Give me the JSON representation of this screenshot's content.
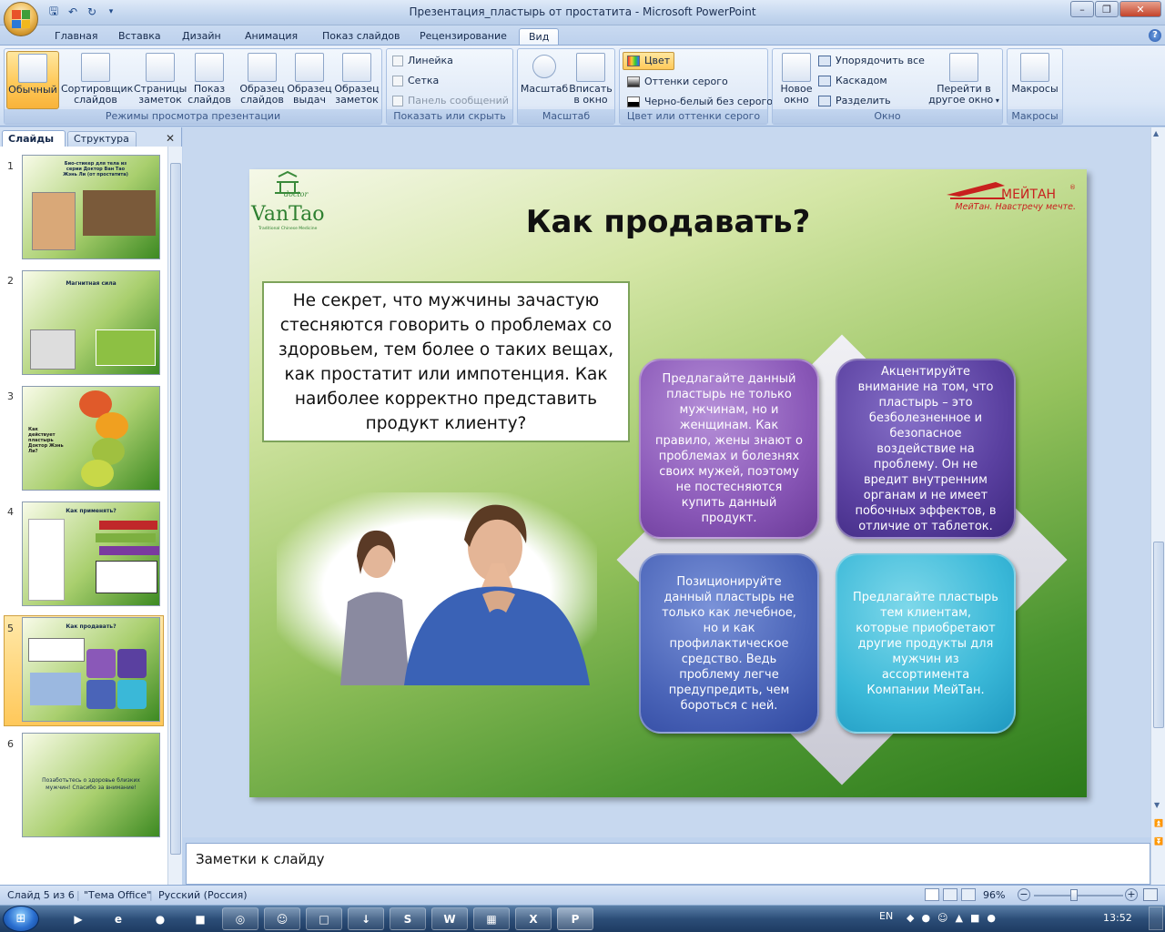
{
  "window": {
    "title": "Презентация_пластырь от простатита - Microsoft PowerPoint"
  },
  "ribbon_tabs": [
    "Главная",
    "Вставка",
    "Дизайн",
    "Анимация",
    "Показ слайдов",
    "Рецензирование",
    "Вид"
  ],
  "active_tab": "Вид",
  "ribbon": {
    "views_group": {
      "label": "Режимы просмотра презентации",
      "buttons": [
        {
          "label1": "Обычный",
          "label2": ""
        },
        {
          "label1": "Сортировщик",
          "label2": "слайдов"
        },
        {
          "label1": "Страницы",
          "label2": "заметок"
        },
        {
          "label1": "Показ",
          "label2": "слайдов"
        },
        {
          "label1": "Образец",
          "label2": "слайдов"
        },
        {
          "label1": "Образец",
          "label2": "выдач"
        },
        {
          "label1": "Образец",
          "label2": "заметок"
        }
      ]
    },
    "show_group": {
      "label": "Показать или скрыть",
      "items": [
        "Линейка",
        "Сетка",
        "Панель сообщений"
      ]
    },
    "zoom_group": {
      "label": "Масштаб",
      "zoom_label": "Масштаб",
      "fit_label1": "Вписать",
      "fit_label2": "в окно"
    },
    "color_group": {
      "label": "Цвет или оттенки серого",
      "items": [
        "Цвет",
        "Оттенки серого",
        "Черно-белый без серого"
      ]
    },
    "window_group": {
      "label": "Окно",
      "new_window1": "Новое",
      "new_window2": "окно",
      "items": [
        "Упорядочить все",
        "Каскадом",
        "Разделить"
      ],
      "switch1": "Перейти в",
      "switch2": "другое окно"
    },
    "macros_group": {
      "label": "Макросы",
      "button": "Макросы"
    }
  },
  "left_panel": {
    "tab_slides": "Слайды",
    "tab_outline": "Структура",
    "slides": [
      {
        "n": "1",
        "title": "Био-стикер для тела из серии Доктор Ван Тао Жэнь Ли (от простатита)"
      },
      {
        "n": "2",
        "title": "Магнитная сила"
      },
      {
        "n": "3",
        "title": "Как действует пластырь Доктор Жэнь Ли?"
      },
      {
        "n": "4",
        "title": "Как применять?"
      },
      {
        "n": "5",
        "title": "Как продавать?"
      },
      {
        "n": "6",
        "title": "Позаботьтесь о здоровье близких мужчин! Спасибо за внимание!"
      }
    ],
    "selected": 5
  },
  "slide": {
    "logo_left_small": "doctor",
    "logo_left": "VanTao",
    "logo_left_sub": "Traditional Chinese Medicine",
    "logo_right": "МЕЙТАН",
    "logo_right_slogan": "МейТан. Навстречу мечте.",
    "title": "Как продавать?",
    "intro": "Не секрет, что мужчины зачастую стесняются говорить о проблемах со здоровьем, тем более о таких вещах, как простатит или импотенция. Как наиболее корректно представить продукт клиенту?",
    "quad1": "Предлагайте данный пластырь не только мужчинам, но и женщинам. Как правило, жены знают о проблемах и болезнях своих мужей, поэтому не постесняются купить данный продукт.",
    "quad2": "Акцентируйте внимание на том, что пластырь – это безболезненное и безопасное воздействие на проблему. Он не вредит внутренним органам и не имеет побочных эффектов, в отличие от таблеток.",
    "quad3": "Позиционируйте данный пластырь не только как лечебное, но и как профилактическое средство. Ведь проблему легче предупредить, чем бороться с ней.",
    "quad4": "Предлагайте пластырь тем клиентам, которые приобретают другие продукты для мужчин из ассортимента Компании МейТан."
  },
  "notes": {
    "placeholder": "Заметки к слайду"
  },
  "status": {
    "slide": "Слайд 5 из 6",
    "theme": "\"Тема Office\"",
    "lang": "Русский (Россия)",
    "zoom": "96%"
  },
  "taskbar": {
    "lang": "EN",
    "time": "13:52"
  },
  "colors": {
    "accent": "#ffc95a",
    "slide_green": "#4a9430"
  }
}
